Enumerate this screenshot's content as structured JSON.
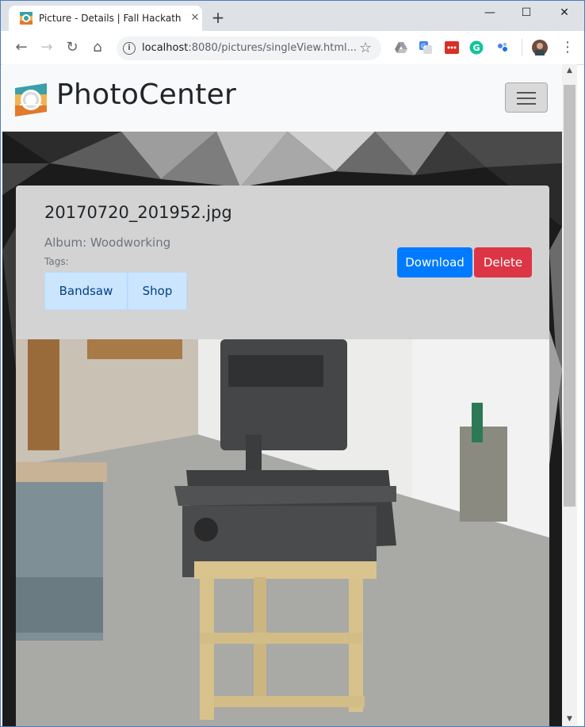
{
  "browser": {
    "tab_title": "Picture - Details | Fall Hackathon",
    "url_host": "localhost",
    "url_rest": ":8080/pictures/singleView.html..."
  },
  "site": {
    "brand": "PhotoCenter"
  },
  "picture": {
    "filename": "20170720_201952.jpg",
    "album_label": "Album:",
    "album_name": "Woodworking",
    "tags_label": "Tags:",
    "tags": [
      "Bandsaw",
      "Shop"
    ]
  },
  "actions": {
    "download": "Download",
    "delete": "Delete"
  },
  "colors": {
    "primary": "#007bff",
    "danger": "#dc3545",
    "tag_bg": "#cce5ff",
    "tag_text": "#004085"
  }
}
